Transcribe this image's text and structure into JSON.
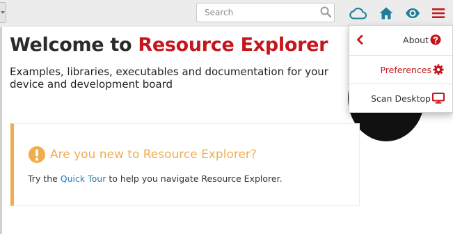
{
  "toolbar": {
    "search": {
      "placeholder": "Search",
      "value": ""
    },
    "icons": [
      "cloud-icon",
      "home-icon",
      "eye-icon",
      "hamburger-menu-icon"
    ]
  },
  "welcome": {
    "title_prefix": "Welcome to ",
    "title_brand": "Resource Explorer",
    "subtitle": "Examples, libraries, executables and documentation for your device and development board"
  },
  "tour_card": {
    "heading": "Are you new to Resource Explorer?",
    "text_before": "Try the ",
    "link_text": "Quick Tour",
    "text_after": " to help you navigate Resource Explorer."
  },
  "menu": {
    "items": [
      {
        "label": "About",
        "icon": "question-circle-icon"
      },
      {
        "label": "Preferences",
        "icon": "gear-icon"
      },
      {
        "label": "Scan Desktop",
        "icon": "desktop-icon"
      }
    ]
  },
  "colors": {
    "brand_red": "#c4161c",
    "toolbar_teal": "#1f7f98",
    "warning_orange": "#f0ad4e",
    "link_blue": "#2a7ab0"
  }
}
